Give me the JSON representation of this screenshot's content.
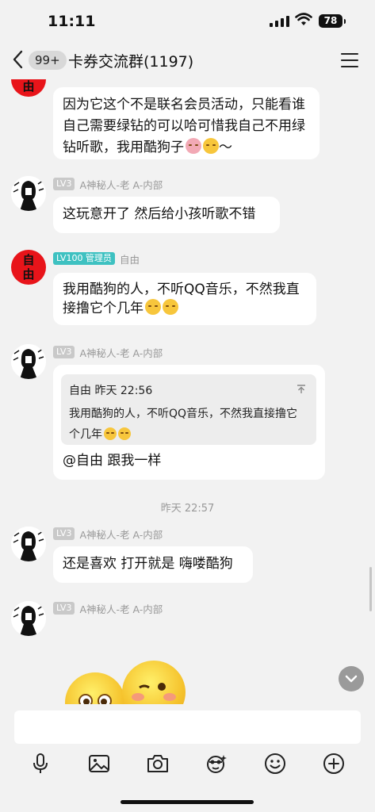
{
  "status": {
    "time": "11:11",
    "battery": "78"
  },
  "nav": {
    "unread_badge": "99+",
    "title": "卡券交流群(1197)"
  },
  "messages": [
    {
      "avatar_text": "自\n由",
      "text": "因为它这个不是联名会员活动，只能看谁自己需要绿钻的可以哈可惜我自己不用绿钻听歌，我用酷狗子",
      "text_tail": "～"
    },
    {
      "level": "LV3",
      "sender": "A神秘人-老 A-内部",
      "text": "这玩意开了 然后给小孩听歌不错"
    },
    {
      "avatar_text": "自\n由",
      "level": "LV100 管理员",
      "sender": "自由",
      "text": "我用酷狗的人，不听QQ音乐，不然我直接撸它个几年"
    },
    {
      "level": "LV3",
      "sender": "A神秘人-老 A-内部",
      "quote_author": "自由  昨天 22:56",
      "quote_text": "我用酷狗的人，不听QQ音乐，不然我直接撸它个几年",
      "text": "@自由 跟我一样"
    },
    {
      "level": "LV3",
      "sender": "A神秘人-老 A-内部",
      "text": "还是喜欢 打开就是 嗨喽酷狗"
    },
    {
      "level": "LV3",
      "sender": "A神秘人-老 A-内部"
    }
  ],
  "timestamp": "昨天 22:57",
  "toolbar": [
    "microphone-icon",
    "image-icon",
    "camera-icon",
    "sticker-face-icon",
    "emoji-icon",
    "plus-icon"
  ]
}
